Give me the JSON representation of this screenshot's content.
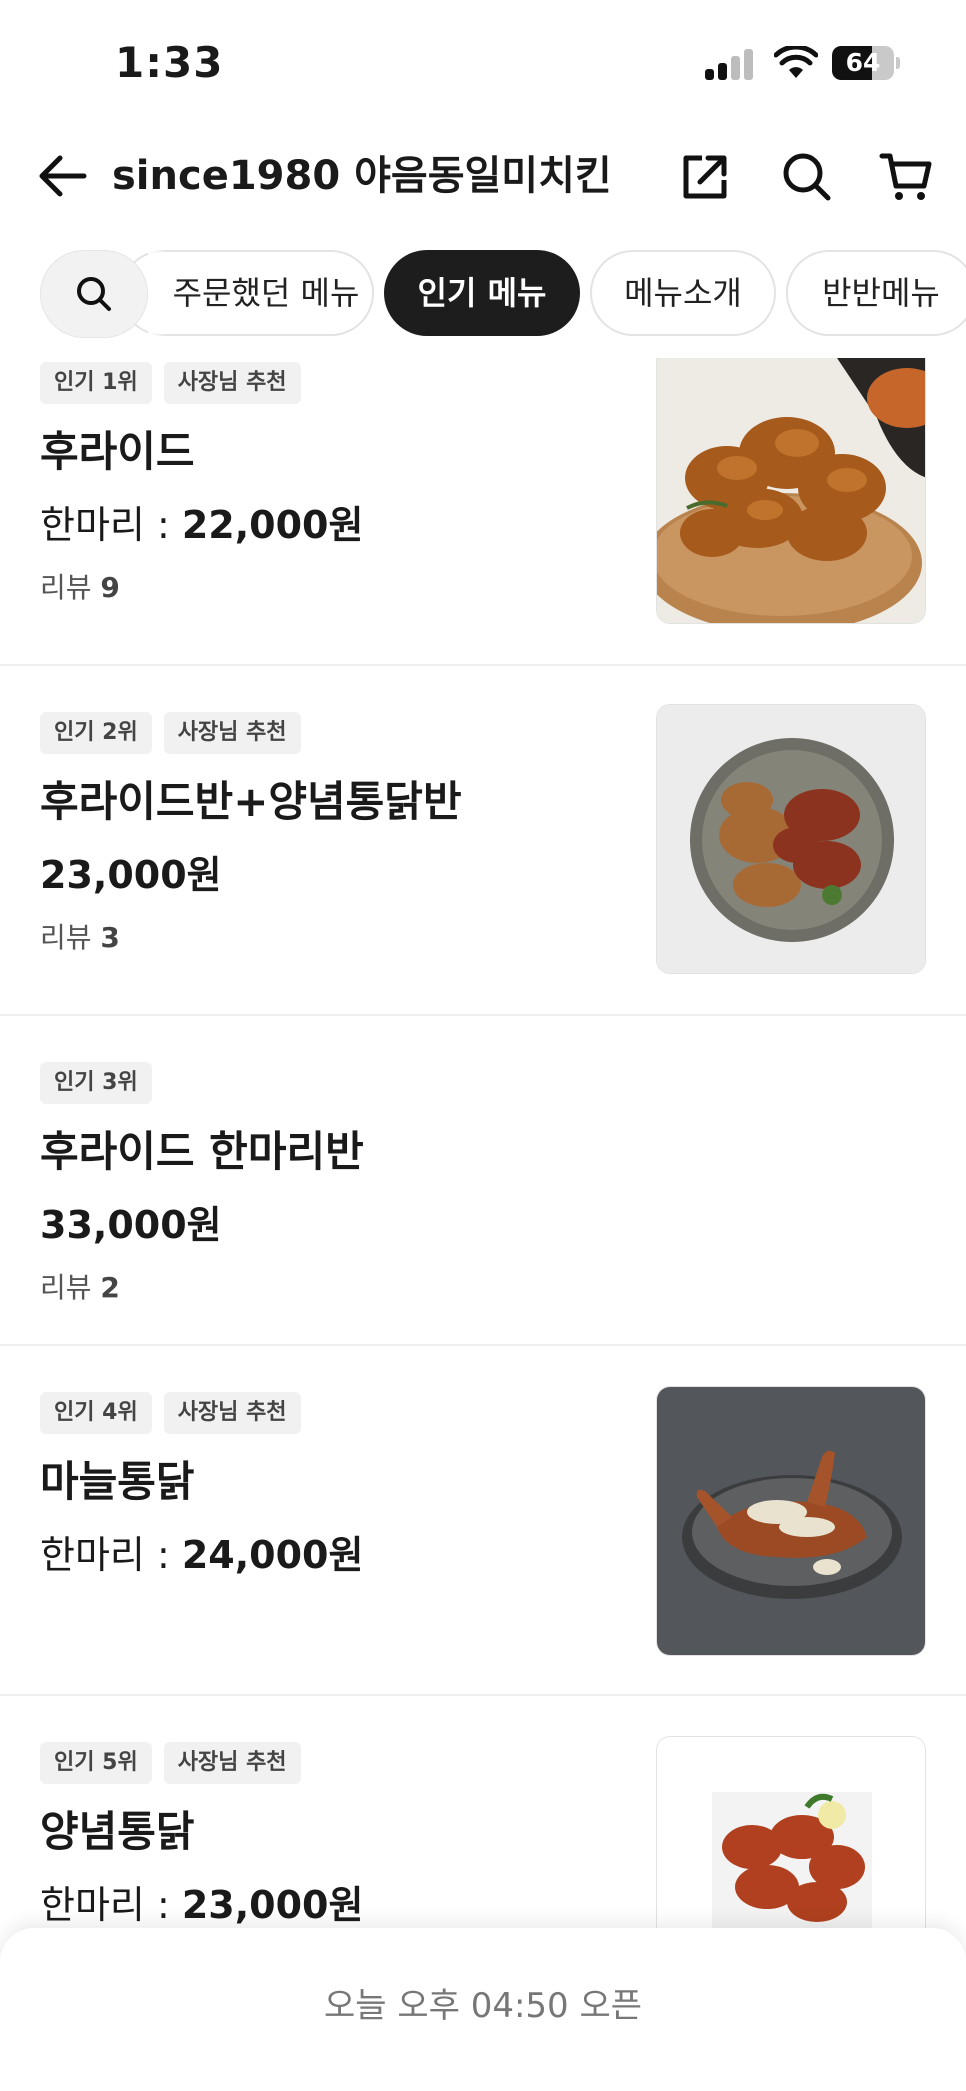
{
  "status_bar": {
    "time": "1:33",
    "battery": "64",
    "battery_level": 0.64
  },
  "header": {
    "title": "since1980 야음동일미치킨"
  },
  "chips": [
    "주문했던 메뉴",
    "인기 메뉴",
    "메뉴소개",
    "반반메뉴"
  ],
  "active_chip": "인기 메뉴",
  "menu": [
    {
      "badges": [
        "인기 1위",
        "사장님 추천"
      ],
      "name": "후라이드",
      "price_label": "한마리 : ",
      "price": "22,000원",
      "review_label": "리뷰 ",
      "review_count": "9",
      "image": "fried-chicken-on-wooden-plate"
    },
    {
      "badges": [
        "인기 2위",
        "사장님 추천"
      ],
      "name": "후라이드반+양념통닭반",
      "price_label": "",
      "price": "23,000원",
      "review_label": "리뷰 ",
      "review_count": "3",
      "image": "half-half-chicken-bowl"
    },
    {
      "badges": [
        "인기 3위"
      ],
      "name": "후라이드 한마리반",
      "price_label": "",
      "price": "33,000원",
      "review_label": "리뷰 ",
      "review_count": "2"
    },
    {
      "badges": [
        "인기 4위",
        "사장님 추천"
      ],
      "name": "마늘통닭",
      "price_label": "한마리 : ",
      "price": "24,000원",
      "image": "garlic-chicken-on-dark-plate"
    },
    {
      "badges": [
        "인기 5위",
        "사장님 추천"
      ],
      "name": "양념통닭",
      "price_label": "한마리 : ",
      "price": "23,000원",
      "image": "seasoned-chicken-plate"
    }
  ],
  "bottom": {
    "open_notice": "오늘 오후 04:50 오픈"
  }
}
